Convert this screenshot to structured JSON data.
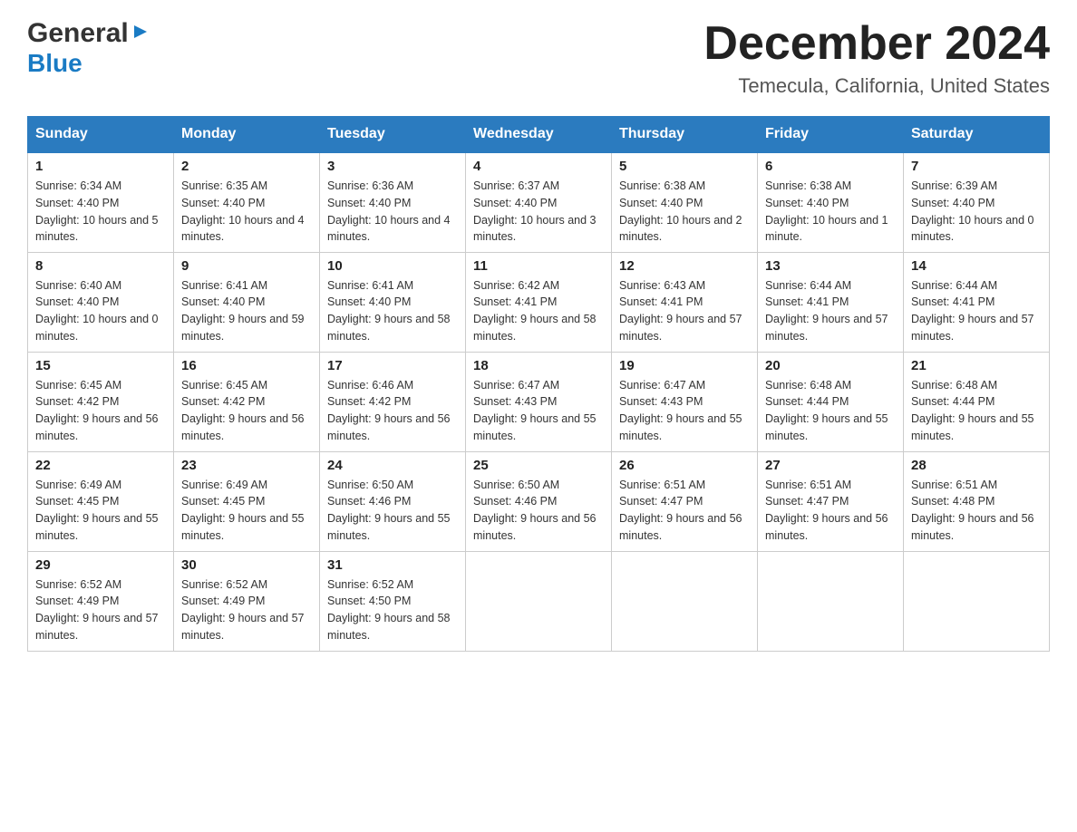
{
  "header": {
    "logo_general": "General",
    "logo_blue": "Blue",
    "month_title": "December 2024",
    "location": "Temecula, California, United States"
  },
  "days_of_week": [
    "Sunday",
    "Monday",
    "Tuesday",
    "Wednesday",
    "Thursday",
    "Friday",
    "Saturday"
  ],
  "weeks": [
    [
      {
        "day": "1",
        "sunrise": "6:34 AM",
        "sunset": "4:40 PM",
        "daylight": "10 hours and 5 minutes."
      },
      {
        "day": "2",
        "sunrise": "6:35 AM",
        "sunset": "4:40 PM",
        "daylight": "10 hours and 4 minutes."
      },
      {
        "day": "3",
        "sunrise": "6:36 AM",
        "sunset": "4:40 PM",
        "daylight": "10 hours and 4 minutes."
      },
      {
        "day": "4",
        "sunrise": "6:37 AM",
        "sunset": "4:40 PM",
        "daylight": "10 hours and 3 minutes."
      },
      {
        "day": "5",
        "sunrise": "6:38 AM",
        "sunset": "4:40 PM",
        "daylight": "10 hours and 2 minutes."
      },
      {
        "day": "6",
        "sunrise": "6:38 AM",
        "sunset": "4:40 PM",
        "daylight": "10 hours and 1 minute."
      },
      {
        "day": "7",
        "sunrise": "6:39 AM",
        "sunset": "4:40 PM",
        "daylight": "10 hours and 0 minutes."
      }
    ],
    [
      {
        "day": "8",
        "sunrise": "6:40 AM",
        "sunset": "4:40 PM",
        "daylight": "10 hours and 0 minutes."
      },
      {
        "day": "9",
        "sunrise": "6:41 AM",
        "sunset": "4:40 PM",
        "daylight": "9 hours and 59 minutes."
      },
      {
        "day": "10",
        "sunrise": "6:41 AM",
        "sunset": "4:40 PM",
        "daylight": "9 hours and 58 minutes."
      },
      {
        "day": "11",
        "sunrise": "6:42 AM",
        "sunset": "4:41 PM",
        "daylight": "9 hours and 58 minutes."
      },
      {
        "day": "12",
        "sunrise": "6:43 AM",
        "sunset": "4:41 PM",
        "daylight": "9 hours and 57 minutes."
      },
      {
        "day": "13",
        "sunrise": "6:44 AM",
        "sunset": "4:41 PM",
        "daylight": "9 hours and 57 minutes."
      },
      {
        "day": "14",
        "sunrise": "6:44 AM",
        "sunset": "4:41 PM",
        "daylight": "9 hours and 57 minutes."
      }
    ],
    [
      {
        "day": "15",
        "sunrise": "6:45 AM",
        "sunset": "4:42 PM",
        "daylight": "9 hours and 56 minutes."
      },
      {
        "day": "16",
        "sunrise": "6:45 AM",
        "sunset": "4:42 PM",
        "daylight": "9 hours and 56 minutes."
      },
      {
        "day": "17",
        "sunrise": "6:46 AM",
        "sunset": "4:42 PM",
        "daylight": "9 hours and 56 minutes."
      },
      {
        "day": "18",
        "sunrise": "6:47 AM",
        "sunset": "4:43 PM",
        "daylight": "9 hours and 55 minutes."
      },
      {
        "day": "19",
        "sunrise": "6:47 AM",
        "sunset": "4:43 PM",
        "daylight": "9 hours and 55 minutes."
      },
      {
        "day": "20",
        "sunrise": "6:48 AM",
        "sunset": "4:44 PM",
        "daylight": "9 hours and 55 minutes."
      },
      {
        "day": "21",
        "sunrise": "6:48 AM",
        "sunset": "4:44 PM",
        "daylight": "9 hours and 55 minutes."
      }
    ],
    [
      {
        "day": "22",
        "sunrise": "6:49 AM",
        "sunset": "4:45 PM",
        "daylight": "9 hours and 55 minutes."
      },
      {
        "day": "23",
        "sunrise": "6:49 AM",
        "sunset": "4:45 PM",
        "daylight": "9 hours and 55 minutes."
      },
      {
        "day": "24",
        "sunrise": "6:50 AM",
        "sunset": "4:46 PM",
        "daylight": "9 hours and 55 minutes."
      },
      {
        "day": "25",
        "sunrise": "6:50 AM",
        "sunset": "4:46 PM",
        "daylight": "9 hours and 56 minutes."
      },
      {
        "day": "26",
        "sunrise": "6:51 AM",
        "sunset": "4:47 PM",
        "daylight": "9 hours and 56 minutes."
      },
      {
        "day": "27",
        "sunrise": "6:51 AM",
        "sunset": "4:47 PM",
        "daylight": "9 hours and 56 minutes."
      },
      {
        "day": "28",
        "sunrise": "6:51 AM",
        "sunset": "4:48 PM",
        "daylight": "9 hours and 56 minutes."
      }
    ],
    [
      {
        "day": "29",
        "sunrise": "6:52 AM",
        "sunset": "4:49 PM",
        "daylight": "9 hours and 57 minutes."
      },
      {
        "day": "30",
        "sunrise": "6:52 AM",
        "sunset": "4:49 PM",
        "daylight": "9 hours and 57 minutes."
      },
      {
        "day": "31",
        "sunrise": "6:52 AM",
        "sunset": "4:50 PM",
        "daylight": "9 hours and 58 minutes."
      },
      null,
      null,
      null,
      null
    ]
  ],
  "labels": {
    "sunrise": "Sunrise:",
    "sunset": "Sunset:",
    "daylight": "Daylight:"
  }
}
